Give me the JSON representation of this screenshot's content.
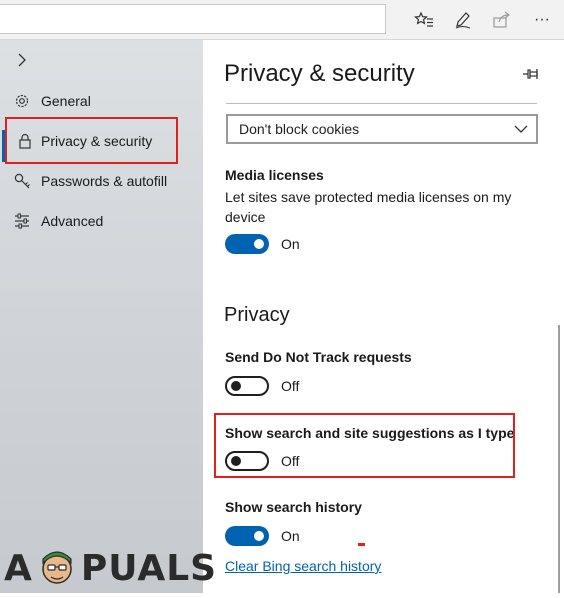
{
  "toolbar": {
    "address_value": "",
    "icons": [
      "favorites-star-icon",
      "pen-icon",
      "share-icon",
      "more-icon"
    ],
    "more_label": "···"
  },
  "sidebar": {
    "items": [
      {
        "label": "General",
        "icon": "gear-icon"
      },
      {
        "label": "Privacy & security",
        "icon": "lock-icon",
        "selected": true
      },
      {
        "label": "Passwords & autofill",
        "icon": "key-icon"
      },
      {
        "label": "Advanced",
        "icon": "sliders-icon"
      }
    ]
  },
  "main": {
    "title": "Privacy & security",
    "cookies_select": {
      "value": "Don't block cookies"
    },
    "media_licenses": {
      "label": "Media licenses",
      "description": "Let sites save protected media licenses on my device",
      "state": "On"
    },
    "privacy_section": "Privacy",
    "do_not_track": {
      "label": "Send Do Not Track requests",
      "state": "Off"
    },
    "search_suggestions": {
      "label": "Show search and site suggestions as I type",
      "state": "Off"
    },
    "search_history": {
      "label": "Show search history",
      "state": "On"
    },
    "clear_history_link": "Clear Bing search history"
  },
  "watermark": {
    "text_left": "A",
    "text_right": "PUALS"
  },
  "colors": {
    "accent": "#0063b1",
    "highlight": "#e0201b"
  }
}
